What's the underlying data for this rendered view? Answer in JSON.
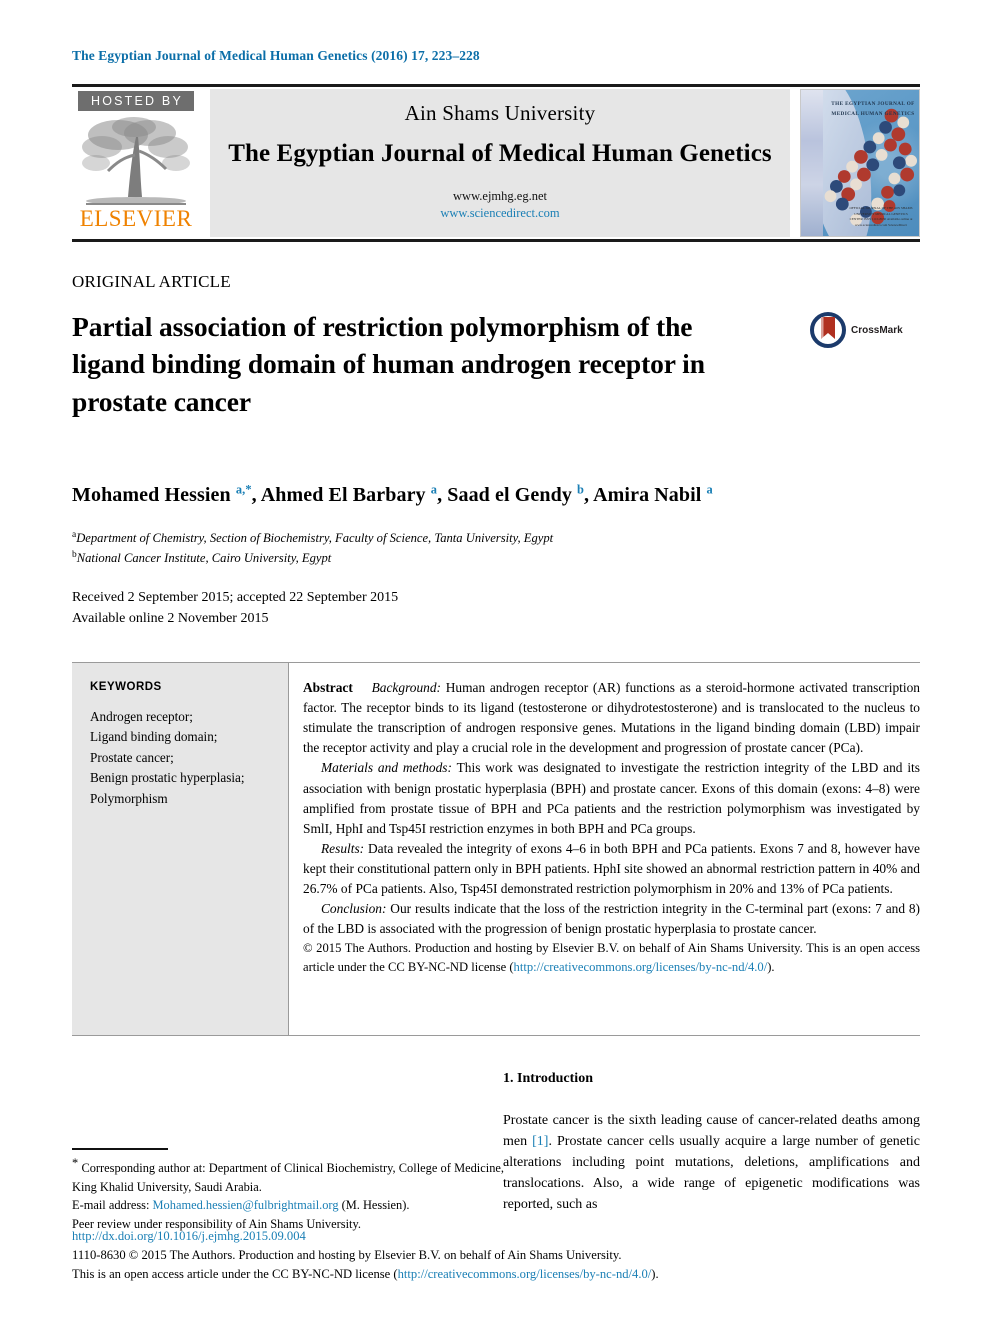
{
  "running_head": "The Egyptian Journal of Medical Human Genetics (2016) 17, 223–228",
  "masthead": {
    "hosted_by": "HOSTED BY",
    "publisher": "ELSEVIER",
    "society": "Ain Shams University",
    "journal_title": "The Egyptian Journal of Medical Human Genetics",
    "url_journal": "www.ejmhg.eg.net",
    "url_sciencedirect": "www.sciencedirect.com",
    "cover_title": "THE EGYPTIAN JOURNAL OF MEDICAL HUMAN GENETICS",
    "cover_footer": "OFFICIAL JOURNAL OF THE AIN SHAMS UNIVERSITY MEDICAL GENETICS CENTER ISSN 1110-8630 Available online at www.sciencedirect.com ScienceDirect"
  },
  "article": {
    "type": "ORIGINAL ARTICLE",
    "title": "Partial association of restriction polymorphism of the ligand binding domain of human androgen receptor in prostate cancer",
    "crossmark_label": "CrossMark",
    "authors_html": "Mohamed Hessien <sup>a,*</sup>, Ahmed El Barbary <sup>a</sup>, Saad el Gendy <sup>b</sup>, Amira Nabil <sup>a</sup>",
    "affiliation_a": "Department of Chemistry, Section of Biochemistry, Faculty of Science, Tanta University, Egypt",
    "affiliation_b": "National Cancer Institute, Cairo University, Egypt",
    "received_line": "Received 2 September 2015; accepted 22 September 2015",
    "available_line": "Available online 2 November 2015"
  },
  "keywords": {
    "heading": "KEYWORDS",
    "items": [
      "Androgen receptor;",
      "Ligand binding domain;",
      "Prostate cancer;",
      "Benign prostatic hyperplasia;",
      "Polymorphism"
    ]
  },
  "abstract": {
    "label": "Abstract",
    "background_label": "Background:",
    "background_text": "Human androgen receptor (AR) functions as a steroid-hormone activated transcription factor. The receptor binds to its ligand (testosterone or dihydrotestosterone) and is translocated to the nucleus to stimulate the transcription of androgen responsive genes. Mutations in the ligand binding domain (LBD) impair the receptor activity and play a crucial role in the development and progression of prostate cancer (PCa).",
    "methods_label": "Materials and methods:",
    "methods_text": "This work was designated to investigate the restriction integrity of the LBD and its association with benign prostatic hyperplasia (BPH) and prostate cancer. Exons of this domain (exons: 4–8) were amplified from prostate tissue of BPH and PCa patients and the restriction polymorphism was investigated by SmlI, HphI and Tsp45I restriction enzymes in both BPH and PCa groups.",
    "results_label": "Results:",
    "results_text": "Data revealed the integrity of exons 4–6 in both BPH and PCa patients. Exons 7 and 8, however have kept their constitutional pattern only in BPH patients. HphI site showed an abnormal restriction pattern in 40% and 26.7% of PCa patients. Also, Tsp45I demonstrated restriction polymorphism in 20% and 13% of PCa patients.",
    "conclusion_label": "Conclusion:",
    "conclusion_text": "Our results indicate that the loss of the restriction integrity in the C-terminal part (exons: 7 and 8) of the LBD is associated with the progression of benign prostatic hyperplasia to prostate cancer.",
    "copyright_text": "© 2015 The Authors. Production and hosting by Elsevier B.V. on behalf of Ain Shams University. This is an open access article under the CC BY-NC-ND license (",
    "copyright_link": "http://creativecommons.org/licenses/by-nc-nd/4.0/",
    "copyright_tail": ")."
  },
  "introduction": {
    "heading": "1. Introduction",
    "paragraph_a": "Prostate cancer is the sixth leading cause of cancer-related deaths among men ",
    "reference": "[1]",
    "paragraph_b": ". Prostate cancer cells usually acquire a large number of genetic alterations including point mutations, deletions, amplifications and translocations. Also, a wide range of epigenetic modifications was reported, such as"
  },
  "footnotes": {
    "corresponding_marker": "*",
    "corresponding_text": "Corresponding author at: Department of Clinical Biochemistry, College of Medicine, King Khalid University, Saudi Arabia.",
    "email_label": "E-mail address:",
    "email_address": "Mohamed.hessien@fulbrightmail.org",
    "email_suffix": "(M. Hessien).",
    "peer_review": "Peer review under responsibility of Ain Shams University.",
    "doi": "http://dx.doi.org/10.1016/j.ejmhg.2015.09.004",
    "issn_copyright": "1110-8630 © 2015 The Authors. Production and hosting by Elsevier B.V. on behalf of Ain Shams University.",
    "license_prefix": "This is an open access article under the CC BY-NC-ND license (",
    "license_link": "http://creativecommons.org/licenses/by-nc-nd/4.0/",
    "license_suffix": ")."
  },
  "colors": {
    "link_blue": "#1a7fb5",
    "running_head_blue": "#0b6ea8",
    "elsevier_orange": "#ef8200",
    "panel_grey": "#e6e6e6",
    "hosted_grey": "#6e6e6e"
  }
}
